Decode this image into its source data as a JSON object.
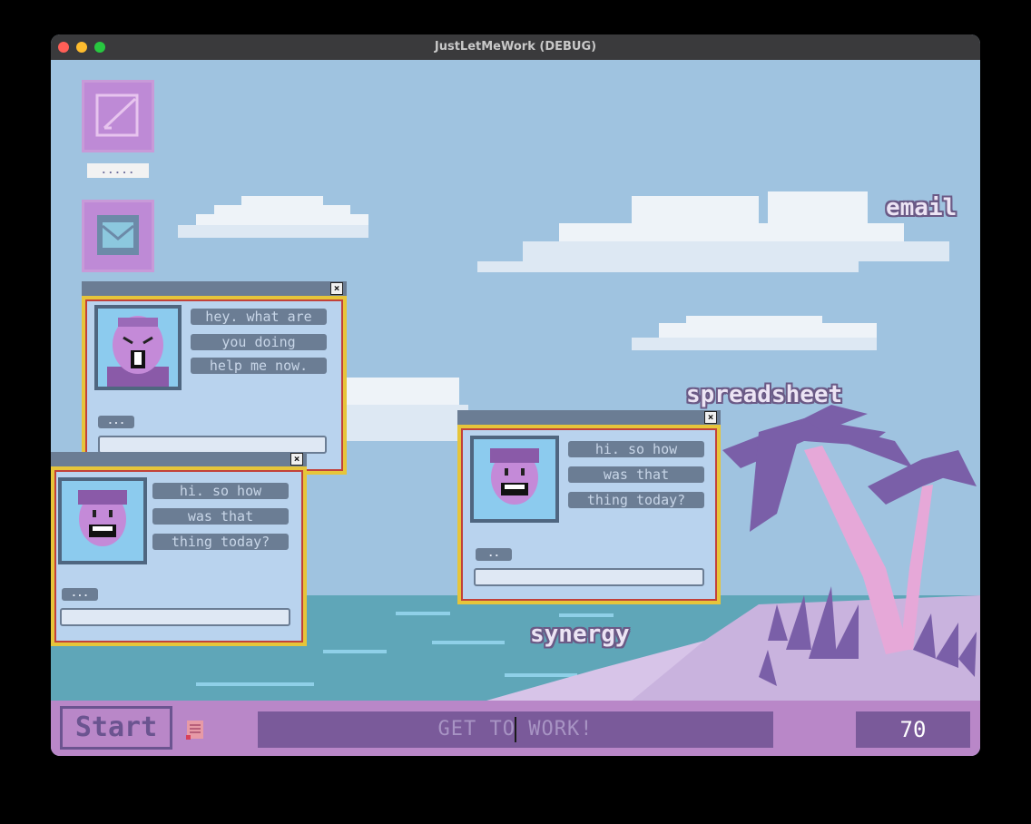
{
  "window": {
    "title": "JustLetMeWork (DEBUG)"
  },
  "desktop_icons": [
    {
      "name": "notepad",
      "label": "....."
    },
    {
      "name": "mail",
      "label": ""
    }
  ],
  "floating_words": [
    "email",
    "spreadsheet",
    "synergy"
  ],
  "chats": [
    {
      "lines": [
        "hey. what are",
        "you doing",
        "help me now."
      ],
      "dots": "..."
    },
    {
      "lines": [
        "hi. so how",
        "was that",
        "thing today?"
      ],
      "dots": "..."
    },
    {
      "lines": [
        "hi. so how",
        "was that",
        "thing today?"
      ],
      "dots": ".."
    }
  ],
  "taskbar": {
    "start_label": "Start",
    "prompt": "GET TO WORK!",
    "score": "70"
  },
  "colors": {
    "sky": "#9fc3e0",
    "sea": "#5fa6b8",
    "sand": "#c9b3de",
    "palm": "#7a5fa8",
    "taskbar": "#b987c8"
  }
}
